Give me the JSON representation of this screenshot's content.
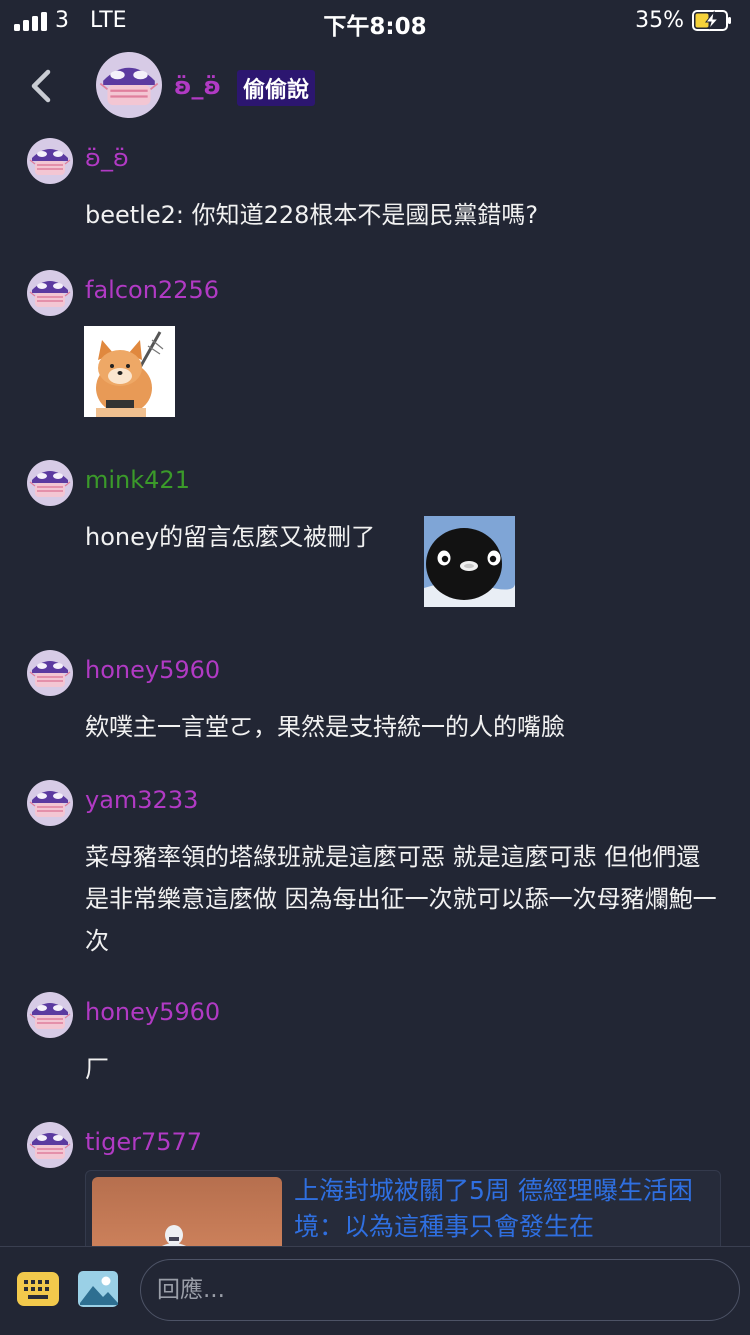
{
  "status": {
    "carrier": "3",
    "network": "LTE",
    "time": "下午8:08",
    "battery": "35%"
  },
  "header": {
    "back_icon": "chevron-left-icon",
    "name": "ʚ̈_ʚ̈",
    "badge": "偷偷說"
  },
  "colors": {
    "purple": "#b13ac4",
    "green": "#3b9a2a",
    "link": "#2f6fe0",
    "background": "#222634"
  },
  "messages": [
    {
      "user": "ʚ̈_ʚ̈",
      "text": "beetle2: 你知道228根本不是國民黨錯嗎?"
    },
    {
      "user": "falcon2256",
      "sticker": "shiba-dog-sticker"
    },
    {
      "user": "mink421",
      "text": "honey的留言怎麼又被刪了",
      "sticker": "penguin-sticker"
    },
    {
      "user": "honey5960",
      "text": "欸噗主一言堂ㄛ，果然是支持統一的人的嘴臉"
    },
    {
      "user": "yam3233",
      "text": "菜母豬率領的塔綠班就是這麼可惡 就是這麼可悲 但他們還是非常樂意這麼做 因為每出征一次就可以舔一次母豬爛鮑一次"
    },
    {
      "user": "honey5960",
      "text": "厂"
    },
    {
      "user": "tiger7577",
      "link_title": "上海封城被關了5周 德經理曝生活困境：以為這種事只會發生在"
    }
  ],
  "composer": {
    "keyboard_icon": "keyboard-icon",
    "image_icon": "image-icon",
    "placeholder": "回應..."
  }
}
